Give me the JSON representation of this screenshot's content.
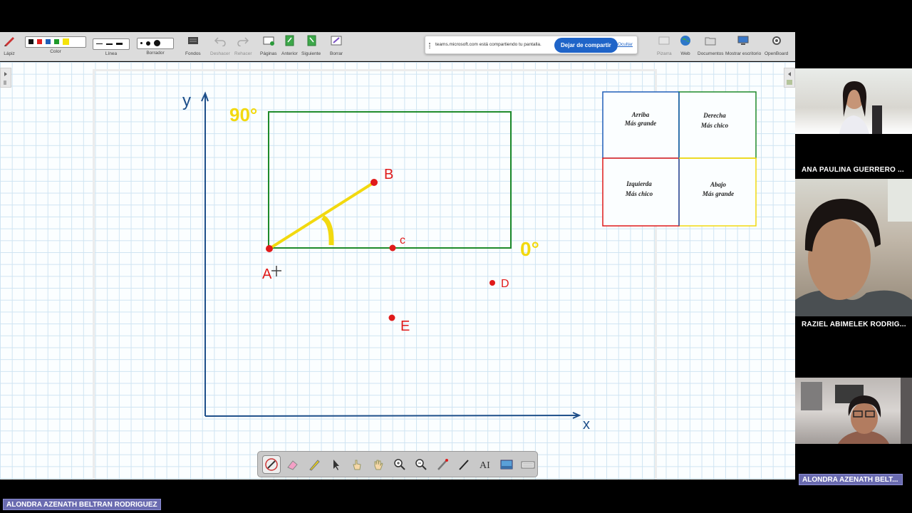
{
  "toolbar": {
    "pen_label": "Lápiz",
    "color_label": "Color",
    "colors": [
      "#111111",
      "#e02020",
      "#1f5fb8",
      "#1e9a2a",
      "#f5e30a"
    ],
    "line_label": "Línea",
    "eraser_label": "Borrador",
    "backgrounds_label": "Fondos",
    "undo_label": "Deshacer",
    "redo_label": "Rehacer",
    "pages_label": "Páginas",
    "previous_label": "Anterior",
    "next_label": "Siguiente",
    "clear_label": "Borrar",
    "podium_label": "Pizarra",
    "web_label": "Web",
    "documents_label": "Documentos",
    "desktop_label": "Mostrar escritorio",
    "openboard_label": "OpenBoard"
  },
  "share_bar": {
    "message": "teams.microsoft.com está compartiendo tu pantalla.",
    "stop_button": "Dejar de compartir",
    "hide_link": "Ocultar"
  },
  "board": {
    "axis_y_label": "y",
    "axis_x_label": "x",
    "angle_90_label": "90°",
    "angle_0_label": "0°",
    "points": {
      "A": "A",
      "B": "B",
      "C": "c",
      "D": "D",
      "E": "E"
    },
    "quadrants": {
      "top_left_line1": "Arriba",
      "top_left_line2": "Más grande",
      "top_right_line1": "Derecha",
      "top_right_line2": "Más chico",
      "bottom_left_line1": "Izquierda",
      "bottom_left_line2": "Más chico",
      "bottom_right_line1": "Abajo",
      "bottom_right_line2": "Más grande"
    },
    "ink_colors": {
      "axes": "#1e4f8a",
      "rectangle": "#1e8a2a",
      "angle": "#f2d90f",
      "points": "#e01a1a"
    }
  },
  "participants": [
    {
      "name": "ANA PAULINA GUERRERO ..."
    },
    {
      "name": "RAZIEL ABIMELEK RODRIG..."
    },
    {
      "name": "ALONDRA AZENATH BELT..."
    }
  ],
  "presenter_name": "ALONDRA AZENATH BELTRAN RODRIGUEZ"
}
